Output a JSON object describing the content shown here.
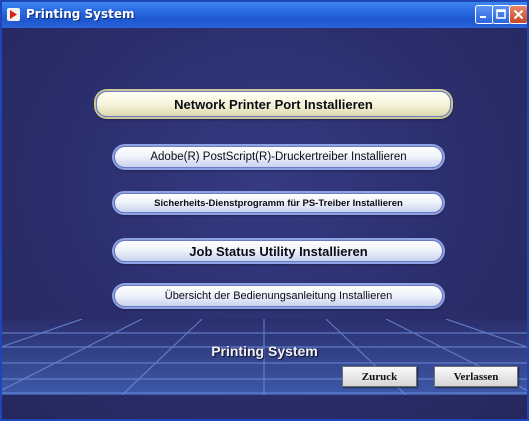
{
  "window": {
    "title": "Printing System",
    "controls": [
      "minimize-icon",
      "maximize-icon",
      "close-icon"
    ]
  },
  "menu": {
    "buttons": [
      {
        "label": "Network Printer Port Installieren"
      },
      {
        "label": "Adobe(R) PostScript(R)-Druckertreiber Installieren"
      },
      {
        "label": "Sicherheits-Dienstprogramm für PS-Treiber Installieren"
      },
      {
        "label": "Job Status Utility Installieren"
      },
      {
        "label": "Übersicht der Bedienungsanleitung Installieren"
      }
    ]
  },
  "footer": {
    "title": "Printing System",
    "back_label": "Zuruck",
    "exit_label": "Verlassen"
  },
  "colors": {
    "titlebar": "#2a6ae0",
    "background": "#2c2f70",
    "grid_line": "#5b78c8"
  }
}
